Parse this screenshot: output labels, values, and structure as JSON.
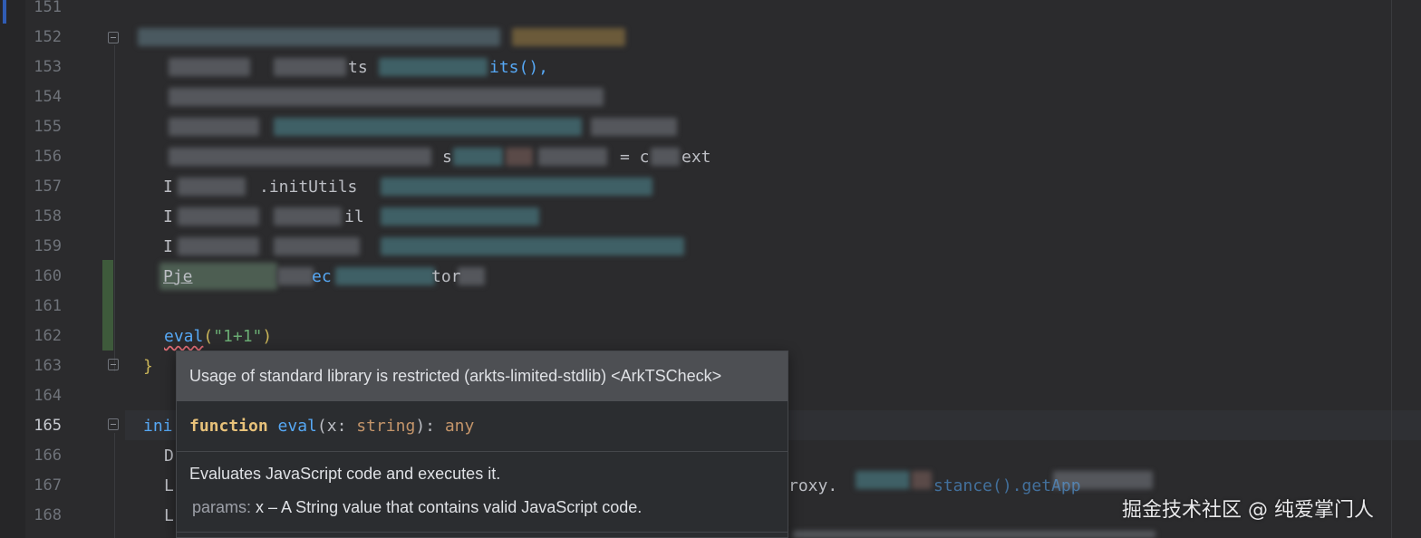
{
  "gutter": {
    "line_numbers": [
      "151",
      "152",
      "153",
      "154",
      "155",
      "156",
      "157",
      "158",
      "159",
      "160",
      "161",
      "162",
      "163",
      "164",
      "165",
      "166",
      "167",
      "168"
    ],
    "active_line": "165"
  },
  "code": {
    "line153_fragment": "ts",
    "line153_tail": "its(),",
    "line156_a": "s",
    "line156_b": "= c",
    "line156_c": "ext",
    "line157_a": "I",
    "line157_b": ".initUtils",
    "line158_a": "I",
    "line158_b": "il",
    "line159_a": "I",
    "line160_a": "Pje",
    "line160_b": "ec",
    "line160_c": "tor",
    "line162_fn": "eval",
    "line162_open": "(",
    "line162_str": "\"1+1\"",
    "line162_close": ")",
    "line163_brace": "}",
    "line165_fn": "ini",
    "line166_a": "D",
    "line167_a": "L",
    "line167_b": "roxy.",
    "line167_c": "stance().getApp",
    "line168_a": "L"
  },
  "popup": {
    "warning": "Usage of standard library is restricted (arkts-limited-stdlib) <ArkTSCheck>",
    "sig_keyword": "function",
    "sig_name": "eval",
    "sig_open": "(",
    "sig_param": "x",
    "sig_colon1": ": ",
    "sig_param_type": "string",
    "sig_close": "): ",
    "sig_return": "any",
    "description": "Evaluates JavaScript code and executes it.",
    "params_label": "params:",
    "params_text": " x – A String value that contains valid JavaScript code."
  },
  "watermark": "掘金技术社区 @ 纯爱掌门人"
}
